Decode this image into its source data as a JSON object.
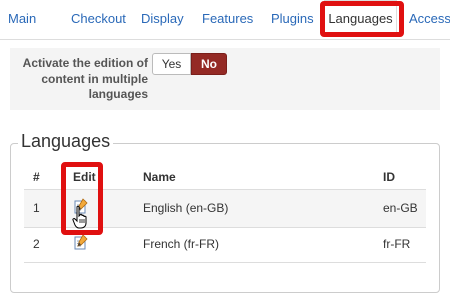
{
  "tabs": [
    {
      "label": "Main"
    },
    {
      "label": "Checkout"
    },
    {
      "label": "Display"
    },
    {
      "label": "Features"
    },
    {
      "label": "Plugins"
    },
    {
      "label": "Languages",
      "active": true
    },
    {
      "label": "Access"
    }
  ],
  "option": {
    "label": "Activate the edition of content in multiple languages",
    "yes_label": "Yes",
    "no_label": "No",
    "selected": "No"
  },
  "languages": {
    "legend": "Languages",
    "columns": {
      "num": "#",
      "edit": "Edit",
      "name": "Name",
      "id": "ID"
    },
    "rows": [
      {
        "num": "1",
        "name": "English (en-GB)",
        "id": "en-GB",
        "edit_icon": "edit-icon"
      },
      {
        "num": "2",
        "name": "French (fr-FR)",
        "id": "fr-FR",
        "edit_icon": "edit-icon"
      }
    ]
  },
  "colors": {
    "accent_link": "#2a69b8",
    "no_active": "#942a25",
    "highlight": "#e01010"
  }
}
